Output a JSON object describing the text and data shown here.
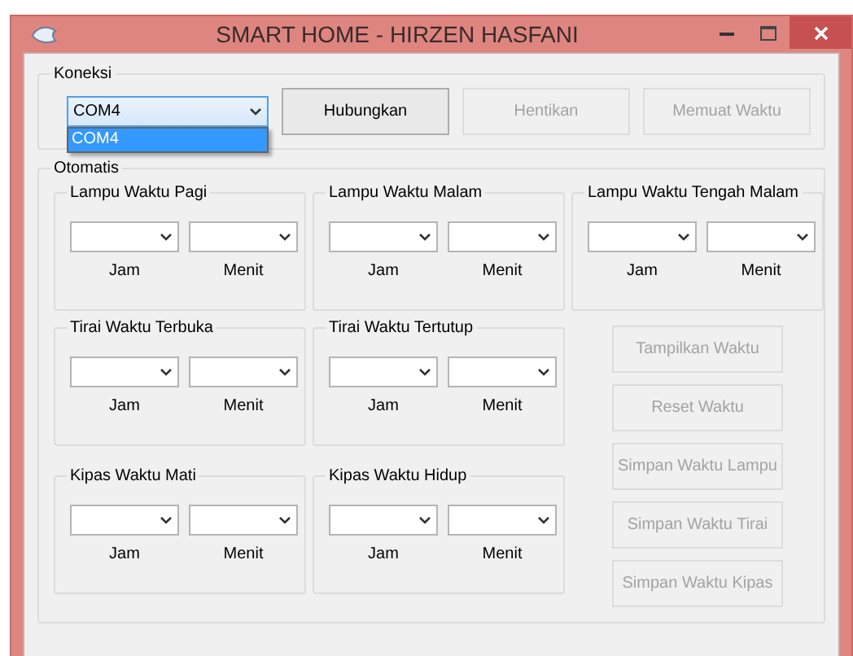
{
  "window": {
    "title": "SMART HOME - HIRZEN HASFANI"
  },
  "connection": {
    "label": "Koneksi",
    "port": {
      "value": "COM4",
      "expanded": true,
      "options": [
        {
          "label": "COM4",
          "selected": true
        }
      ]
    },
    "buttons": [
      {
        "label": "Hubungkan",
        "disabled": false
      },
      {
        "label": "Hentikan",
        "disabled": true
      },
      {
        "label": "Memuat Waktu",
        "disabled": true
      }
    ]
  },
  "automatic": {
    "label": "Otomatis",
    "groups": [
      {
        "title": "Lampu Waktu Pagi",
        "fields": [
          {
            "label": "Jam"
          },
          {
            "label": "Menit"
          }
        ]
      },
      {
        "title": "Lampu Waktu Malam",
        "fields": [
          {
            "label": "Jam"
          },
          {
            "label": "Menit"
          }
        ]
      },
      {
        "title": "Lampu Waktu Tengah Malam",
        "fields": [
          {
            "label": "Jam"
          },
          {
            "label": "Menit"
          }
        ]
      },
      {
        "title": "Tirai Waktu Terbuka",
        "fields": [
          {
            "label": "Jam"
          },
          {
            "label": "Menit"
          }
        ]
      },
      {
        "title": "Tirai Waktu Tertutup",
        "fields": [
          {
            "label": "Jam"
          },
          {
            "label": "Menit"
          }
        ]
      },
      {
        "title": "Kipas Waktu Mati",
        "fields": [
          {
            "label": "Jam"
          },
          {
            "label": "Menit"
          }
        ]
      },
      {
        "title": "Kipas Waktu Hidup",
        "fields": [
          {
            "label": "Jam"
          },
          {
            "label": "Menit"
          }
        ]
      }
    ],
    "buttons": [
      {
        "label": "Tampilkan Waktu",
        "disabled": true
      },
      {
        "label": "Reset Waktu",
        "disabled": true
      },
      {
        "label": "Simpan Waktu Lampu",
        "disabled": true
      },
      {
        "label": "Simpan Waktu Tirai",
        "disabled": true
      },
      {
        "label": "Simpan Waktu Kipas",
        "disabled": true
      }
    ]
  }
}
